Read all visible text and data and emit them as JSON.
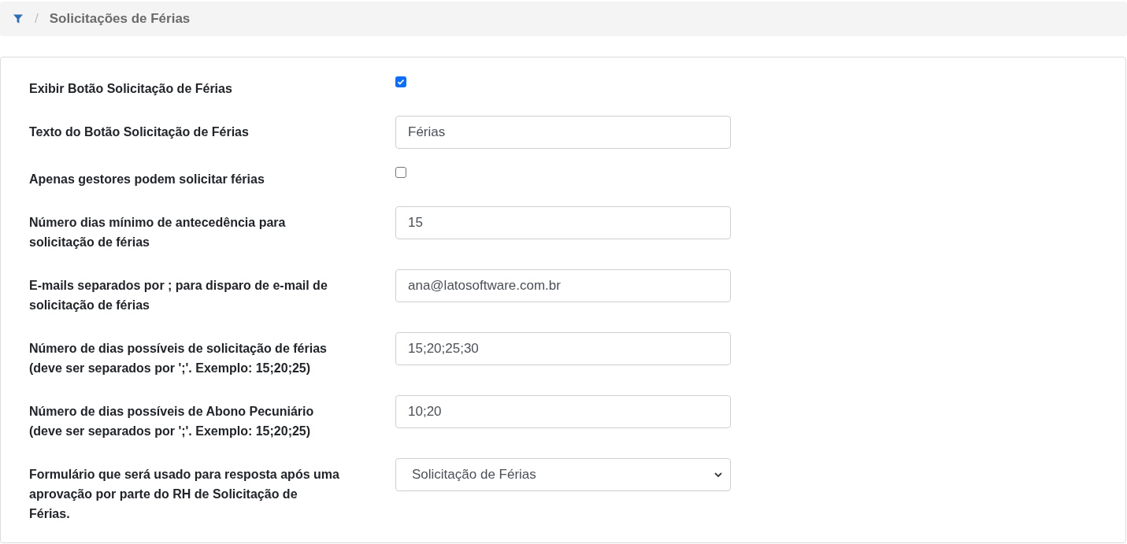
{
  "breadcrumb": {
    "separator": "/",
    "title": "Solicitações de Férias"
  },
  "fields": [
    {
      "kind": "checkbox",
      "label": "Exibir Botão Solicitação de Férias",
      "checked": true
    },
    {
      "kind": "text",
      "label": "Texto do Botão Solicitação de Férias",
      "value": "Férias"
    },
    {
      "kind": "checkbox",
      "label": "Apenas gestores podem solicitar férias",
      "checked": false
    },
    {
      "kind": "text",
      "label": "Número dias mínimo de antecedência para solicitação de férias",
      "value": "15"
    },
    {
      "kind": "text",
      "label": "E-mails separados por ; para disparo de e-mail de solicitação de férias",
      "value": "ana@latosoftware.com.br"
    },
    {
      "kind": "text",
      "label": "Número de dias possíveis de solicitação de férias (deve ser separados por ';'. Exemplo: 15;20;25)",
      "value": "15;20;25;30"
    },
    {
      "kind": "text",
      "label": "Número de dias possíveis de Abono Pecuniário (deve ser separados por ';'. Exemplo: 15;20;25)",
      "value": "10;20"
    },
    {
      "kind": "select",
      "label": "Formulário que será usado para resposta após uma aprovação por parte do RH de Solicitação de Férias.",
      "value": "Solicitação de Férias"
    }
  ]
}
